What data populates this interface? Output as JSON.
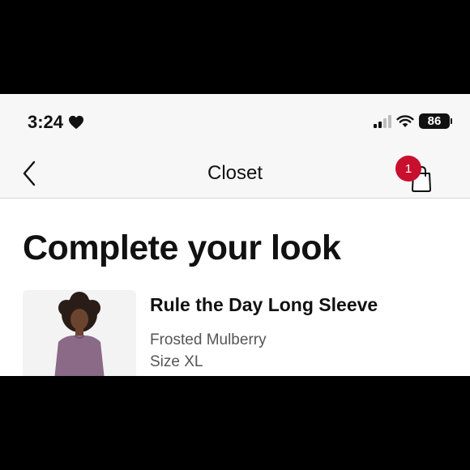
{
  "status_bar": {
    "time": "3:24",
    "battery": "86"
  },
  "nav": {
    "title": "Closet",
    "cart_count": "1"
  },
  "main": {
    "heading": "Complete your look",
    "product": {
      "name": "Rule the Day Long Sleeve",
      "color": "Frosted Mulberry",
      "size": "Size XL",
      "swatch_color": "#8a6a86"
    }
  },
  "colors": {
    "badge": "#c8102e",
    "header_bg": "#f7f7f7"
  }
}
